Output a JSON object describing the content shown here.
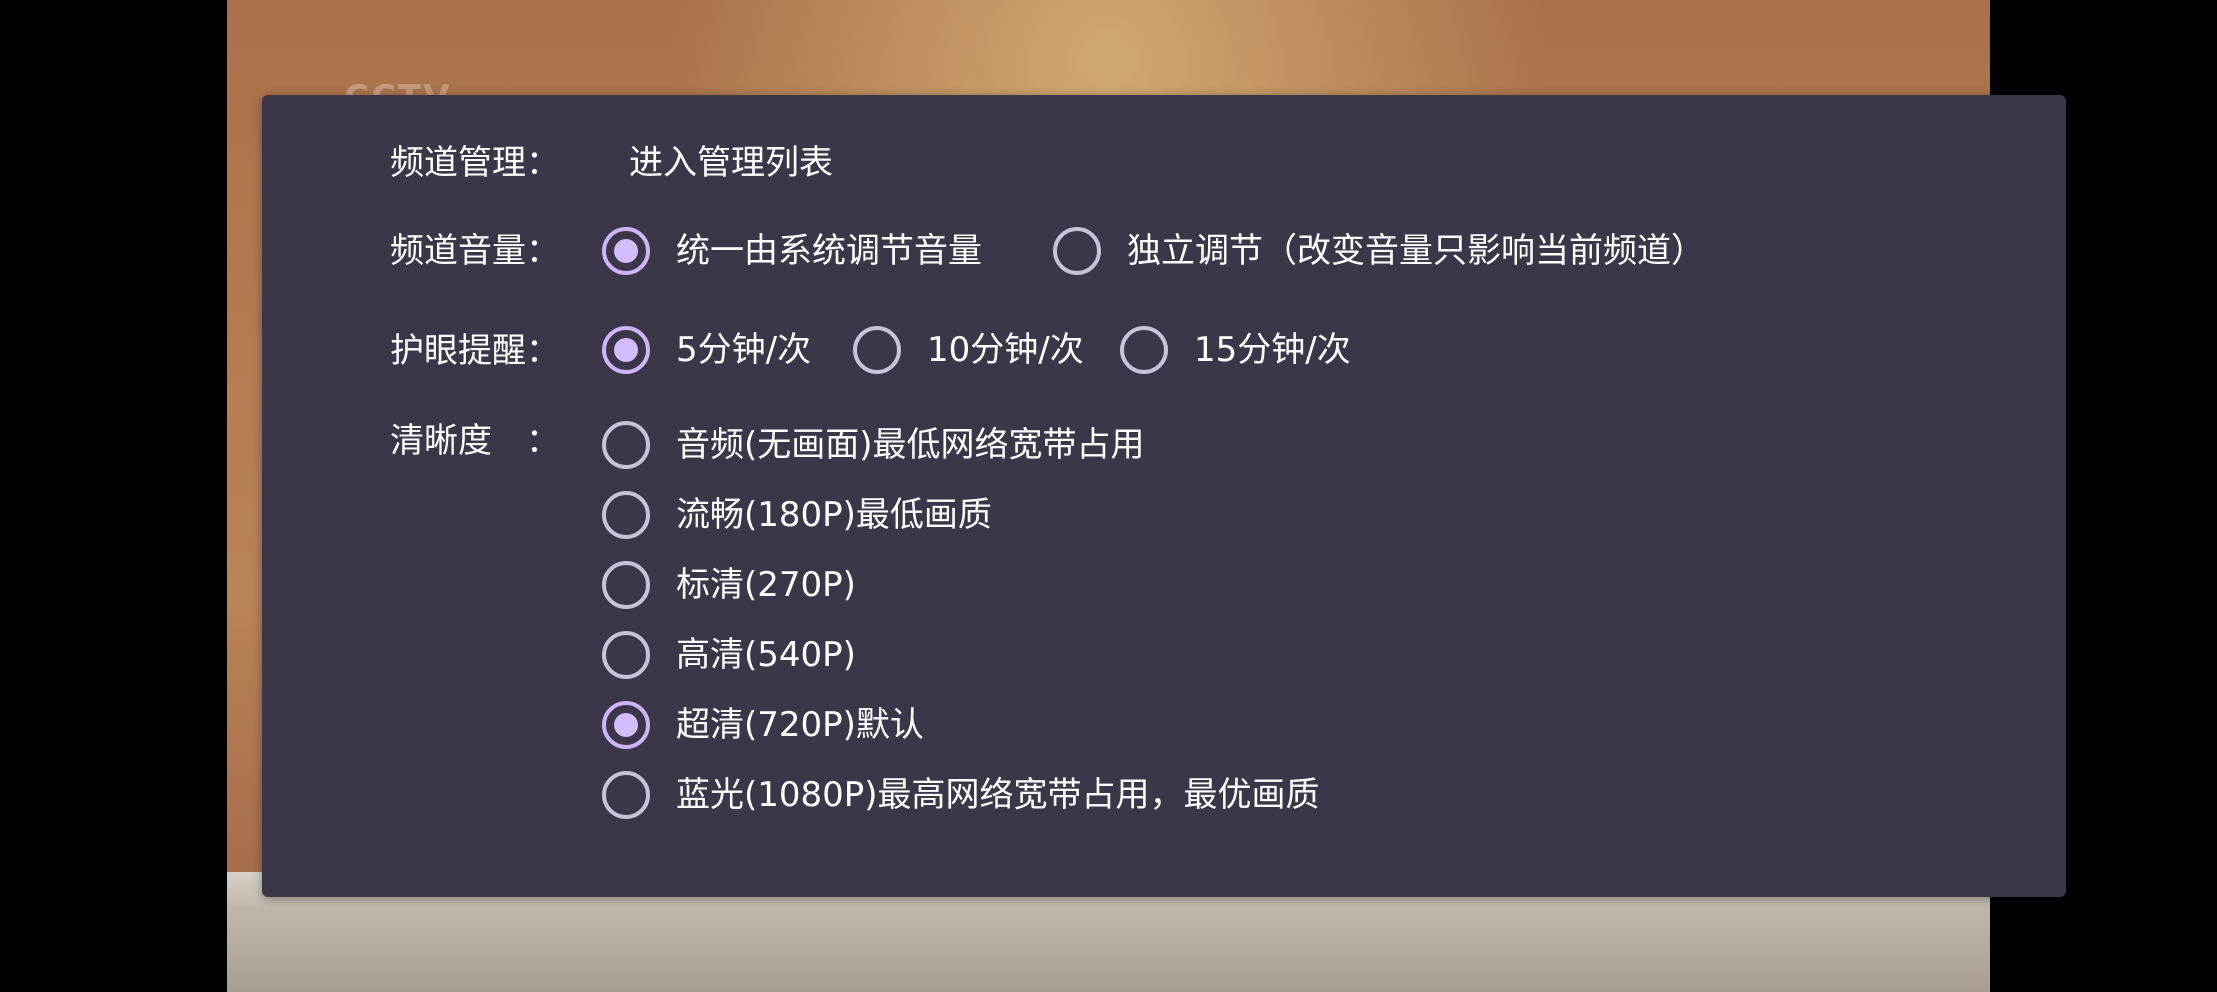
{
  "background": {
    "logo_text": "CCTV"
  },
  "dialog": {
    "channel_manage": {
      "label": "频道管理：",
      "action": "进入管理列表"
    },
    "channel_volume": {
      "label": "频道音量：",
      "options": [
        {
          "label": "统一由系统调节音量",
          "checked": true
        },
        {
          "label": "独立调节（改变音量只影响当前频道）",
          "checked": false
        }
      ]
    },
    "eye_reminder": {
      "label": "护眼提醒：",
      "options": [
        {
          "label": "5分钟/次",
          "checked": true
        },
        {
          "label": "10分钟/次",
          "checked": false
        },
        {
          "label": "15分钟/次",
          "checked": false
        }
      ]
    },
    "definition": {
      "label": "清晰度　：",
      "options": [
        {
          "label": "音频(无画面)最低网络宽带占用",
          "checked": false
        },
        {
          "label": "流畅(180P)最低画质",
          "checked": false
        },
        {
          "label": "标清(270P)",
          "checked": false
        },
        {
          "label": "高清(540P)",
          "checked": false
        },
        {
          "label": "超清(720P)默认",
          "checked": true
        },
        {
          "label": "蓝光(1080P)最高网络宽带占用，最优画质",
          "checked": false
        }
      ]
    }
  },
  "colors": {
    "dialog_bg": "#3b3749",
    "radio_accent": "#d3bcfc",
    "radio_border": "#c8c2d9"
  }
}
